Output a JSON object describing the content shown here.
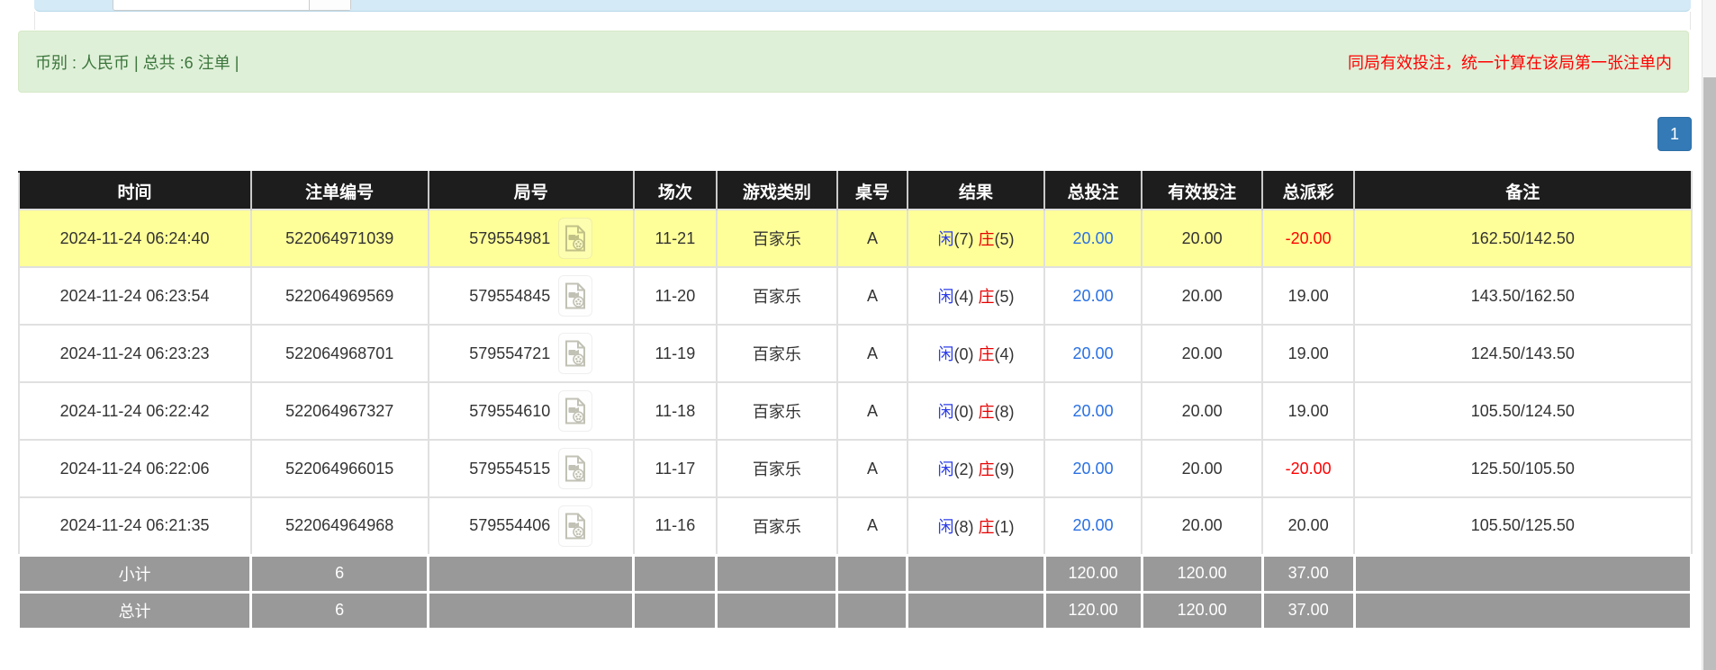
{
  "alert": {
    "left_text": "币别 : 人民币 | 总共 :6 注单 |",
    "right_text": "同局有效投注，统一计算在该局第一张注单内",
    "bg_color": "#dff0d8",
    "left_text_color": "#3c763d",
    "right_text_color": "#ff0000"
  },
  "pagination": {
    "current_page": "1",
    "active_color": "#337ab7"
  },
  "table": {
    "headers": [
      "时间",
      "注单编号",
      "局号",
      "场次",
      "游戏类别",
      "桌号",
      "结果",
      "总投注",
      "有效投注",
      "总派彩",
      "备注"
    ],
    "icon_name": "video-record-icon",
    "rows": [
      {
        "highlighted": true,
        "time": "2024-11-24 06:24:40",
        "bet_no": "522064971039",
        "round_no": "579554981",
        "session": "11-21",
        "game": "百家乐",
        "table_no": "A",
        "result": {
          "player_label": "闲",
          "player_value": "(7)",
          "banker_label": "庄",
          "banker_value": "(5)"
        },
        "total_bet": "20.00",
        "valid_bet": "20.00",
        "payout": "-20.00",
        "remark": "162.50/142.50"
      },
      {
        "highlighted": false,
        "time": "2024-11-24 06:23:54",
        "bet_no": "522064969569",
        "round_no": "579554845",
        "session": "11-20",
        "game": "百家乐",
        "table_no": "A",
        "result": {
          "player_label": "闲",
          "player_value": "(4)",
          "banker_label": "庄",
          "banker_value": "(5)"
        },
        "total_bet": "20.00",
        "valid_bet": "20.00",
        "payout": "19.00",
        "remark": "143.50/162.50"
      },
      {
        "highlighted": false,
        "time": "2024-11-24 06:23:23",
        "bet_no": "522064968701",
        "round_no": "579554721",
        "session": "11-19",
        "game": "百家乐",
        "table_no": "A",
        "result": {
          "player_label": "闲",
          "player_value": "(0)",
          "banker_label": "庄",
          "banker_value": "(4)"
        },
        "total_bet": "20.00",
        "valid_bet": "20.00",
        "payout": "19.00",
        "remark": "124.50/143.50"
      },
      {
        "highlighted": false,
        "time": "2024-11-24 06:22:42",
        "bet_no": "522064967327",
        "round_no": "579554610",
        "session": "11-18",
        "game": "百家乐",
        "table_no": "A",
        "result": {
          "player_label": "闲",
          "player_value": "(0)",
          "banker_label": "庄",
          "banker_value": "(8)"
        },
        "total_bet": "20.00",
        "valid_bet": "20.00",
        "payout": "19.00",
        "remark": "105.50/124.50"
      },
      {
        "highlighted": false,
        "time": "2024-11-24 06:22:06",
        "bet_no": "522064966015",
        "round_no": "579554515",
        "session": "11-17",
        "game": "百家乐",
        "table_no": "A",
        "result": {
          "player_label": "闲",
          "player_value": "(2)",
          "banker_label": "庄",
          "banker_value": "(9)"
        },
        "total_bet": "20.00",
        "valid_bet": "20.00",
        "payout": "-20.00",
        "remark": "125.50/105.50"
      },
      {
        "highlighted": false,
        "time": "2024-11-24 06:21:35",
        "bet_no": "522064964968",
        "round_no": "579554406",
        "session": "11-16",
        "game": "百家乐",
        "table_no": "A",
        "result": {
          "player_label": "闲",
          "player_value": "(8)",
          "banker_label": "庄",
          "banker_value": "(1)"
        },
        "total_bet": "20.00",
        "valid_bet": "20.00",
        "payout": "20.00",
        "remark": "105.50/125.50"
      }
    ],
    "footer": [
      {
        "label": "小计",
        "count": "6",
        "total_bet": "120.00",
        "valid_bet": "120.00",
        "payout": "37.00"
      },
      {
        "label": "总计",
        "count": "6",
        "total_bet": "120.00",
        "valid_bet": "120.00",
        "payout": "37.00"
      }
    ]
  },
  "colors": {
    "header_bg": "#1d1d1d",
    "row_highlight": "#ffff99",
    "footer_gray": "#999999",
    "link_blue": "#2970e3",
    "player_blue": "#2b3ce8",
    "banker_red": "#e60000",
    "negative_red": "#ff0000"
  }
}
